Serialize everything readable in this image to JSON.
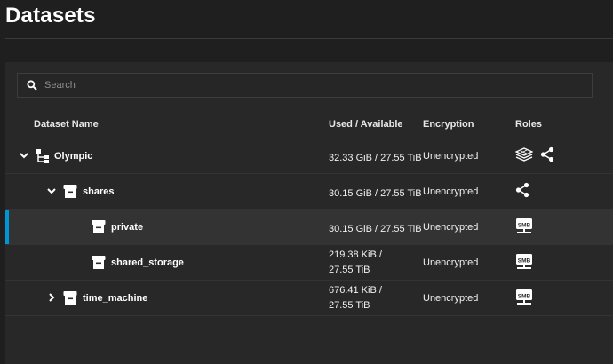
{
  "page": {
    "title": "Datasets"
  },
  "search": {
    "placeholder": "Search",
    "value": ""
  },
  "table": {
    "columns": {
      "name": "Dataset Name",
      "used": "Used / Available",
      "encryption": "Encryption",
      "roles": "Roles"
    },
    "rows": [
      {
        "name": "Olympic",
        "used": "32.33 GiB / 27.55 TiB",
        "encryption": "Unencrypted",
        "roles": [
          "dataset-root-icon",
          "share-icon"
        ],
        "expand": "expanded",
        "selected": false
      },
      {
        "name": "shares",
        "used": "30.15 GiB / 27.55 TiB",
        "encryption": "Unencrypted",
        "roles": [
          "share-icon"
        ],
        "expand": "expanded",
        "selected": false
      },
      {
        "name": "private",
        "used": "30.15 GiB / 27.55 TiB",
        "encryption": "Unencrypted",
        "roles": [
          "smb-share-icon"
        ],
        "expand": "none",
        "selected": true
      },
      {
        "name": "shared_storage",
        "used_line1": "219.38 KiB /",
        "used_line2": "27.55 TiB",
        "encryption": "Unencrypted",
        "roles": [
          "smb-share-icon"
        ],
        "expand": "none",
        "selected": false
      },
      {
        "name": "time_machine",
        "used_line1": "676.41 KiB /",
        "used_line2": "27.55 TiB",
        "encryption": "Unencrypted",
        "roles": [
          "smb-share-icon"
        ],
        "expand": "collapsed",
        "selected": false
      }
    ]
  },
  "smb_label": "SMB",
  "colors": {
    "background": "#1f1f1f",
    "card": "#282828",
    "selected_row": "#333333",
    "accent": "#0095d5"
  }
}
